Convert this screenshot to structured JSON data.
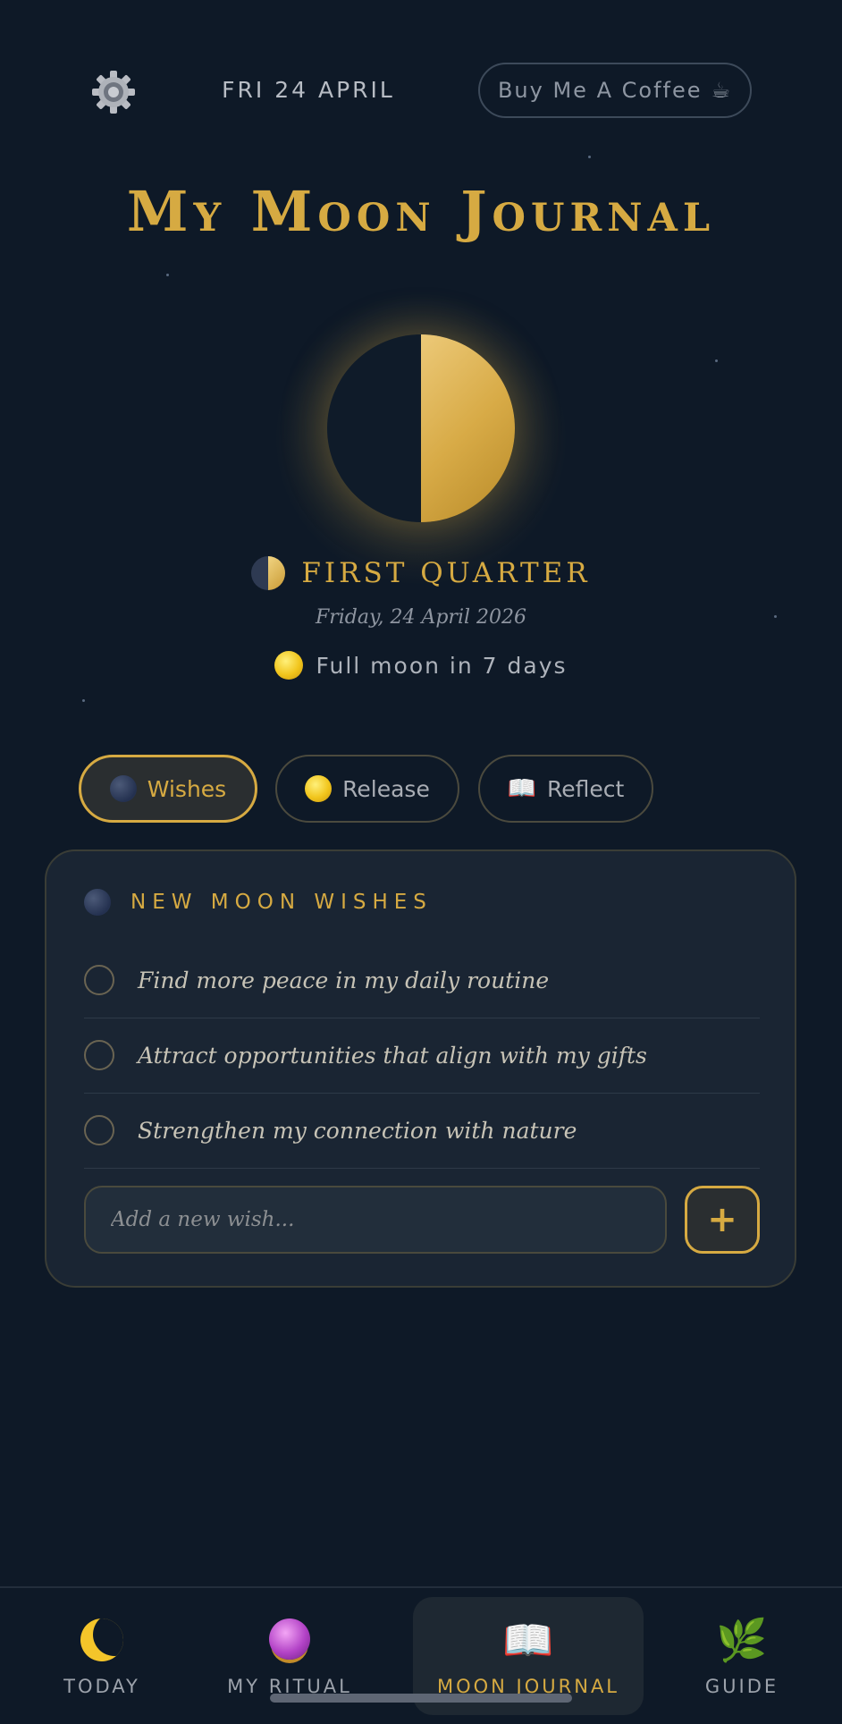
{
  "header": {
    "date": "FRI 24 APRIL",
    "coffee_label": "Buy Me A Coffee",
    "coffee_icon": "☕"
  },
  "title": "My Moon Journal",
  "moon": {
    "phase": "FIRST QUARTER",
    "full_date": "Friday, 24 April 2026",
    "full_moon_note": "Full moon in 7 days",
    "illumination": 0.5
  },
  "tabs": [
    {
      "label": "Wishes",
      "active": true
    },
    {
      "label": "Release",
      "active": false
    },
    {
      "label": "Reflect",
      "active": false,
      "icon": "📖"
    }
  ],
  "card": {
    "title": "NEW MOON WISHES",
    "wishes": [
      "Find more peace in my daily routine",
      "Attract opportunities that align with my gifts",
      "Strengthen my connection with nature"
    ],
    "input_placeholder": "Add a new wish...",
    "add_label": "+"
  },
  "nav": [
    {
      "label": "TODAY",
      "icon": "crescent-moon-icon"
    },
    {
      "label": "MY RITUAL",
      "icon": "crystal-ball-icon"
    },
    {
      "label": "MOON JOURNAL",
      "icon": "📖",
      "active": true
    },
    {
      "label": "GUIDE",
      "icon": "🌿"
    }
  ],
  "colors": {
    "background": "#0e1927",
    "accent_gold": "#d6aa42",
    "card": "#1a2533"
  }
}
